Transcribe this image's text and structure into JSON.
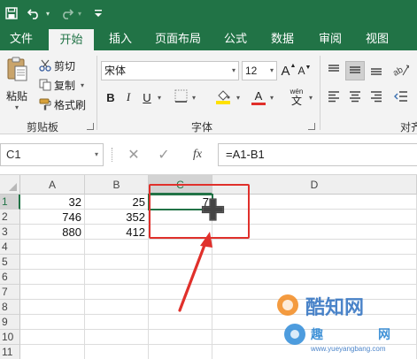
{
  "quick_access": {
    "save_icon": "save-icon",
    "undo_icon": "undo-icon",
    "redo_icon": "redo-icon",
    "customize_icon": "customize-quick-access-icon"
  },
  "tabs": [
    {
      "label": "文件",
      "active": false
    },
    {
      "label": "开始",
      "active": true
    },
    {
      "label": "插入",
      "active": false
    },
    {
      "label": "页面布局",
      "active": false
    },
    {
      "label": "公式",
      "active": false
    },
    {
      "label": "数据",
      "active": false
    },
    {
      "label": "审阅",
      "active": false
    },
    {
      "label": "视图",
      "active": false
    }
  ],
  "clipboard": {
    "paste_label": "粘贴",
    "cut_label": "剪切",
    "copy_label": "复制",
    "format_painter_label": "格式刷",
    "group_label": "剪贴板"
  },
  "font": {
    "font_name": "宋体",
    "font_size": "12",
    "grow_label": "A",
    "shrink_label": "A",
    "bold_label": "B",
    "italic_label": "I",
    "underline_label": "U",
    "wen_label": "wén",
    "wen_char": "文",
    "font_color_label": "A",
    "font_color": "#e02f2a",
    "fill_color": "#ffe100",
    "group_label": "字体"
  },
  "alignment": {
    "group_label": "对齐"
  },
  "formula_bar": {
    "name_box": "C1",
    "cancel_symbol": "✕",
    "enter_symbol": "✓",
    "fx_label": "fx",
    "formula": "=A1-B1"
  },
  "sheet": {
    "columns": [
      "A",
      "B",
      "C",
      "D"
    ],
    "selected_column": "C",
    "rows": [
      {
        "row": "1",
        "A": "32",
        "B": "25",
        "C": "7"
      },
      {
        "row": "2",
        "A": "746",
        "B": "352",
        "C": ""
      },
      {
        "row": "3",
        "A": "880",
        "B": "412",
        "C": ""
      },
      {
        "row": "4",
        "A": "",
        "B": "",
        "C": ""
      },
      {
        "row": "5",
        "A": "",
        "B": "",
        "C": ""
      },
      {
        "row": "6",
        "A": "",
        "B": "",
        "C": ""
      },
      {
        "row": "7",
        "A": "",
        "B": "",
        "C": ""
      },
      {
        "row": "8",
        "A": "",
        "B": "",
        "C": ""
      },
      {
        "row": "9",
        "A": "",
        "B": "",
        "C": ""
      },
      {
        "row": "10",
        "A": "",
        "B": "",
        "C": ""
      },
      {
        "row": "11",
        "A": "",
        "B": "",
        "C": ""
      }
    ],
    "selected_row": "1"
  },
  "colors": {
    "excel_green": "#217346",
    "annotation_red": "#e0302b"
  },
  "watermark": {
    "brand": "酷知网",
    "site": "www.yueyangbang.com",
    "chars": "趣",
    "tail": "网"
  }
}
